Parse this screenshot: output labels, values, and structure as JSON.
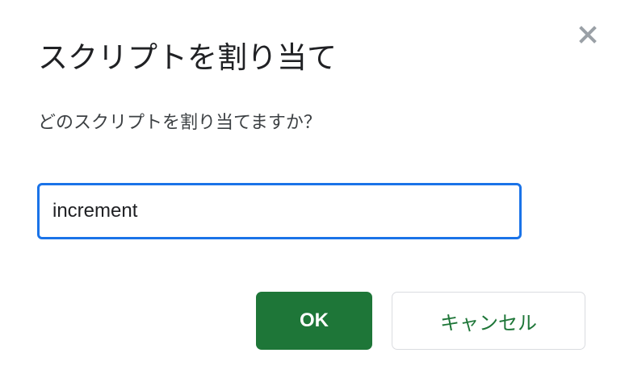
{
  "dialog": {
    "title": "スクリプトを割り当て",
    "prompt": "どのスクリプトを割り当てますか？",
    "input_value": "increment",
    "ok_label": "OK",
    "cancel_label": "キャンセル",
    "close_icon": "close-icon"
  },
  "colors": {
    "accent_green": "#1e7638",
    "focus_blue": "#1a73e8",
    "title_text": "#202124",
    "close_icon": "#9aa0a6"
  }
}
